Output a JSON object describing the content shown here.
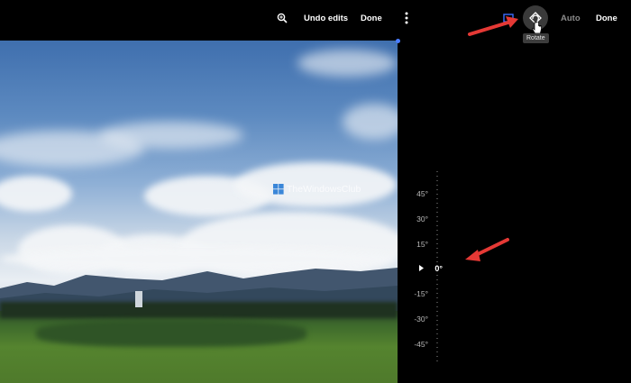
{
  "topbar": {
    "zoom_icon": "zoom-in-icon",
    "undo_label": "Undo edits",
    "done_label_left": "Done",
    "more_icon": "more-vertical-icon",
    "crop_icon": "crop-icon",
    "rotate_icon": "rotate-icon",
    "auto_label": "Auto",
    "done_label_right": "Done"
  },
  "tooltip": {
    "text": "Rotate"
  },
  "watermark": {
    "text": "TheWindowsClub"
  },
  "dial": {
    "labels": [
      "45°",
      "30°",
      "15°",
      "0°",
      "-15°",
      "-30°",
      "-45°"
    ],
    "current": "0°"
  },
  "colors": {
    "accent": "#4a7dff",
    "arrow": "#e53935",
    "background": "#000000"
  }
}
